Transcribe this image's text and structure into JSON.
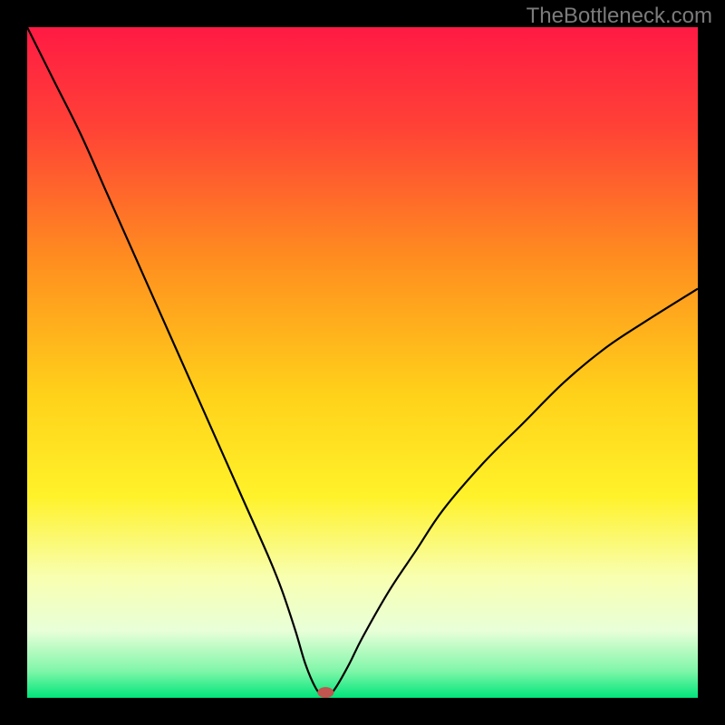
{
  "watermark": "TheBottleneck.com",
  "chart_data": {
    "type": "line",
    "title": "",
    "xlabel": "",
    "ylabel": "",
    "xlim": [
      0,
      100
    ],
    "ylim": [
      0,
      100
    ],
    "background_gradient": {
      "stops": [
        {
          "offset": 0.0,
          "color": "#ff1a44"
        },
        {
          "offset": 0.15,
          "color": "#ff4236"
        },
        {
          "offset": 0.35,
          "color": "#ff8f1f"
        },
        {
          "offset": 0.55,
          "color": "#ffd21a"
        },
        {
          "offset": 0.7,
          "color": "#fff22a"
        },
        {
          "offset": 0.82,
          "color": "#f8ffb0"
        },
        {
          "offset": 0.9,
          "color": "#e8ffd8"
        },
        {
          "offset": 0.96,
          "color": "#80f6a9"
        },
        {
          "offset": 1.0,
          "color": "#00e57a"
        }
      ]
    },
    "series": [
      {
        "name": "bottleneck-curve",
        "note": "V-shaped curve: minimum (optimal) near x≈44; y rises steeply toward 100 as x→0 and more gradually toward ~60 as x→100",
        "points": [
          {
            "x": 0.0,
            "y": 100.0
          },
          {
            "x": 4.0,
            "y": 92.0
          },
          {
            "x": 8.0,
            "y": 84.0
          },
          {
            "x": 12.0,
            "y": 75.0
          },
          {
            "x": 16.0,
            "y": 66.0
          },
          {
            "x": 20.0,
            "y": 57.0
          },
          {
            "x": 24.0,
            "y": 48.0
          },
          {
            "x": 28.0,
            "y": 39.0
          },
          {
            "x": 32.0,
            "y": 30.0
          },
          {
            "x": 36.0,
            "y": 21.0
          },
          {
            "x": 38.0,
            "y": 16.0
          },
          {
            "x": 40.0,
            "y": 10.0
          },
          {
            "x": 41.5,
            "y": 5.0
          },
          {
            "x": 43.0,
            "y": 1.5
          },
          {
            "x": 44.0,
            "y": 0.5
          },
          {
            "x": 45.0,
            "y": 0.5
          },
          {
            "x": 46.0,
            "y": 1.5
          },
          {
            "x": 48.0,
            "y": 5.0
          },
          {
            "x": 50.0,
            "y": 9.0
          },
          {
            "x": 54.0,
            "y": 16.0
          },
          {
            "x": 58.0,
            "y": 22.0
          },
          {
            "x": 62.0,
            "y": 28.0
          },
          {
            "x": 68.0,
            "y": 35.0
          },
          {
            "x": 74.0,
            "y": 41.0
          },
          {
            "x": 80.0,
            "y": 47.0
          },
          {
            "x": 86.0,
            "y": 52.0
          },
          {
            "x": 92.0,
            "y": 56.0
          },
          {
            "x": 100.0,
            "y": 61.0
          }
        ]
      }
    ],
    "marker": {
      "name": "optimal-point",
      "x": 44.5,
      "y": 0.8,
      "color": "#c1554f",
      "rx": 9,
      "ry": 6
    }
  }
}
